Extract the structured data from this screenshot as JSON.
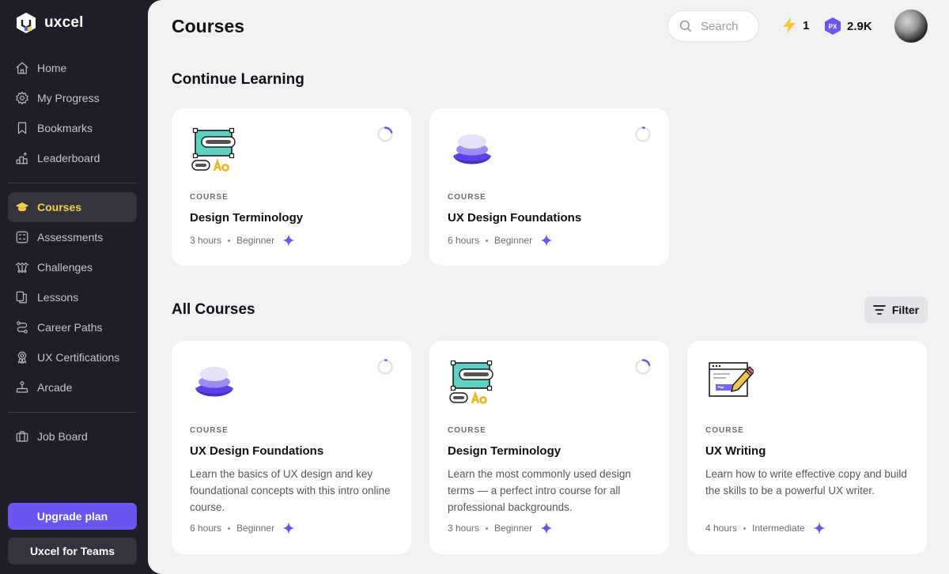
{
  "brand": {
    "name": "uxcel"
  },
  "sidebar": {
    "items": [
      {
        "label": "Home",
        "icon": "home-icon"
      },
      {
        "label": "My Progress",
        "icon": "progress-gear-icon"
      },
      {
        "label": "Bookmarks",
        "icon": "bookmark-icon"
      },
      {
        "label": "Leaderboard",
        "icon": "leaderboard-icon"
      },
      {
        "label": "Courses",
        "icon": "graduation-cap-icon",
        "active": true
      },
      {
        "label": "Assessments",
        "icon": "assessment-icon"
      },
      {
        "label": "Challenges",
        "icon": "challenges-icon"
      },
      {
        "label": "Lessons",
        "icon": "lessons-icon"
      },
      {
        "label": "Career Paths",
        "icon": "career-path-icon"
      },
      {
        "label": "UX Certifications",
        "icon": "certification-icon"
      },
      {
        "label": "Arcade",
        "icon": "joystick-icon"
      },
      {
        "label": "Job Board",
        "icon": "briefcase-icon"
      }
    ],
    "upgrade_label": "Upgrade plan",
    "teams_label": "Uxcel for Teams"
  },
  "header": {
    "title": "Courses",
    "search_placeholder": "Search",
    "streak": "1",
    "px_badge": "PX",
    "px_points": "2.9K"
  },
  "continue_learning": {
    "title": "Continue Learning",
    "cards": [
      {
        "eyebrow": "COURSE",
        "title": "Design Terminology",
        "duration": "3 hours",
        "level": "Beginner",
        "progress": 0.2,
        "illustration": "artboard-font-icon"
      },
      {
        "eyebrow": "COURSE",
        "title": "UX Design Foundations",
        "duration": "6 hours",
        "level": "Beginner",
        "progress": 0.03,
        "illustration": "layers-icon"
      }
    ]
  },
  "all_courses": {
    "title": "All Courses",
    "filter_label": "Filter",
    "cards": [
      {
        "eyebrow": "COURSE",
        "title": "UX Design Foundations",
        "description": "Learn the basics of UX design and key foundational concepts with this intro online course.",
        "duration": "6 hours",
        "level": "Beginner",
        "progress": 0.03,
        "illustration": "layers-icon"
      },
      {
        "eyebrow": "COURSE",
        "title": "Design Terminology",
        "description": "Learn the most commonly used design terms — a perfect intro course for all professional backgrounds.",
        "duration": "3 hours",
        "level": "Beginner",
        "progress": 0.2,
        "illustration": "artboard-font-icon"
      },
      {
        "eyebrow": "COURSE",
        "title": "UX Writing",
        "description": "Learn how to write effective copy and build the skills to be a powerful UX writer.",
        "duration": "4 hours",
        "level": "Intermediate",
        "progress": 0,
        "illustration": "writing-pencil-icon"
      }
    ]
  },
  "colors": {
    "accent": "#6a55f2",
    "active_nav": "#f7d047",
    "sidebar_bg": "#1e1f26",
    "main_bg": "#f2f2f4"
  }
}
